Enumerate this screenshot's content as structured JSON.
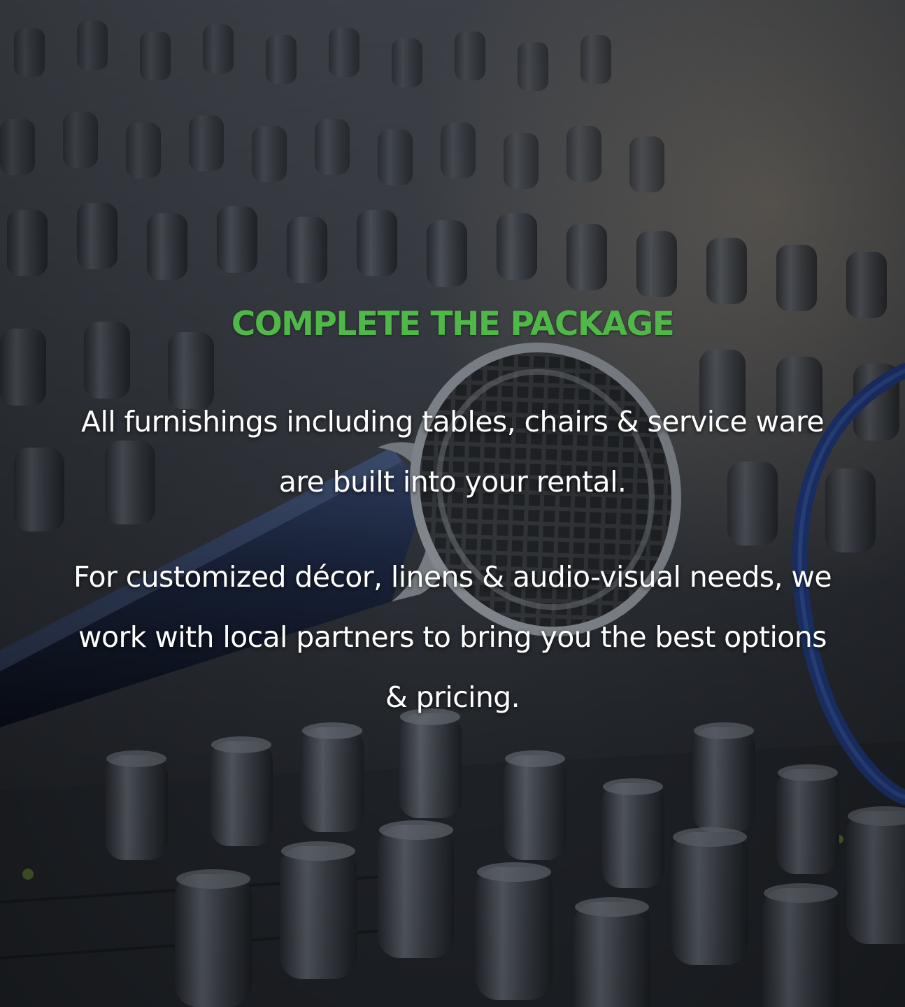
{
  "section": {
    "heading": "COMPLETE THE PACKAGE",
    "paragraphs": [
      "All furnishings including tables, chairs & service ware are built into your rental.",
      "For customized décor, linens & audio-visual needs, we work with local partners to bring you the best options & pricing."
    ],
    "background_image": "audio-mixer-microphone-photo"
  },
  "colors": {
    "heading": "#4fb848",
    "body_text": "#ffffff"
  }
}
